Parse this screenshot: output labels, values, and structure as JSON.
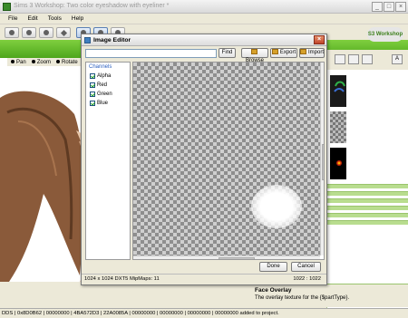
{
  "window": {
    "title": "Sims 3 Workshop: Two color eyeshadow with eyeliner *",
    "controls": {
      "minimize": "_",
      "maximize": "□",
      "close": "×"
    }
  },
  "menu": [
    "File",
    "Edit",
    "Tools",
    "Help"
  ],
  "logo_text": "S3 Workshop",
  "viewport_tools": [
    "Pan",
    "Zoom",
    "Rotate"
  ],
  "right_panel": {
    "letter_button": "A"
  },
  "face_overlay": {
    "title": "Face Overlay",
    "description": "The overlay texture for the {$partType}."
  },
  "status_bar": "DDS | 0x8D0B62 | 00000000 | 4BA572D3 | 22A0085A | 00000000 | 00000000 | 00000000 | 00000000 added to project.",
  "image_editor": {
    "title": "Image Editor",
    "path_value": "",
    "buttons": {
      "find": "Find",
      "browse": "Browse",
      "export": "Export",
      "import": "Import",
      "done": "Done",
      "cancel": "Cancel"
    },
    "channels": {
      "header": "Channels",
      "items": [
        {
          "label": "Alpha",
          "checked": true
        },
        {
          "label": "Red",
          "checked": true
        },
        {
          "label": "Green",
          "checked": true
        },
        {
          "label": "Blue",
          "checked": true
        }
      ]
    },
    "info_left": "1024 x 1024 DXT5 MipMaps: 11",
    "info_right": "1022 : 1022"
  },
  "colors": {
    "accent_green": "#5cb82a",
    "dialog_title_icon": "#3f7fc0"
  }
}
